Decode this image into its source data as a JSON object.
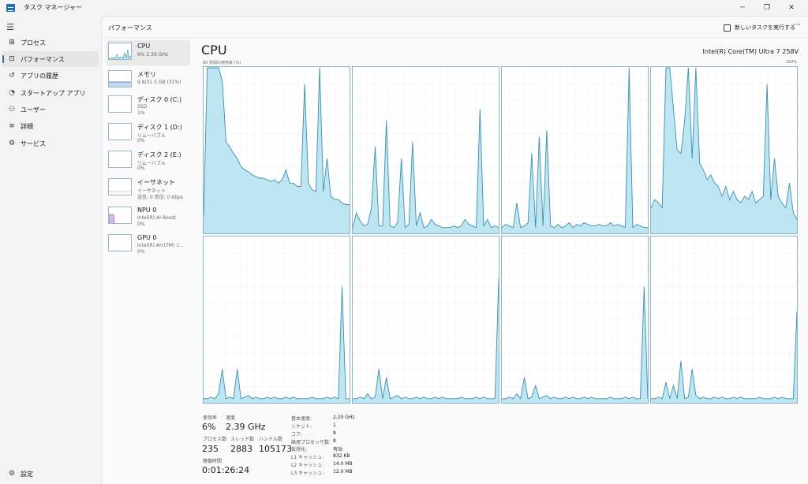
{
  "window": {
    "title": "タスク マネージャー"
  },
  "nav": {
    "items": [
      {
        "label": "プロセス",
        "icon": "grid-icon"
      },
      {
        "label": "パフォーマンス",
        "icon": "pulse-icon"
      },
      {
        "label": "アプリの履歴",
        "icon": "history-icon"
      },
      {
        "label": "スタートアップ アプリ",
        "icon": "gauge-icon"
      },
      {
        "label": "ユーザー",
        "icon": "users-icon"
      },
      {
        "label": "詳細",
        "icon": "list-icon"
      },
      {
        "label": "サービス",
        "icon": "puzzle-icon"
      }
    ],
    "settings": "設定"
  },
  "header": {
    "title": "パフォーマンス",
    "new_task": "新しいタスクを実行する",
    "more": "⋯"
  },
  "devices": [
    {
      "name": "CPU",
      "sub1": "6% 2.39 GHz",
      "sub2": ""
    },
    {
      "name": "メモリ",
      "sub1": "9.8/31.5 GB (31%)",
      "sub2": ""
    },
    {
      "name": "ディスク 0 (C:)",
      "sub1": "SSD",
      "sub2": "1%"
    },
    {
      "name": "ディスク 1 (D:)",
      "sub1": "リムーバブル",
      "sub2": "0%"
    },
    {
      "name": "ディスク 2 (E:)",
      "sub1": "リムーバブル",
      "sub2": "0%"
    },
    {
      "name": "イーサネット",
      "sub1": "イーサネット",
      "sub2": "送信: 0 受信: 0 Kbps"
    },
    {
      "name": "NPU 0",
      "sub1": "Intel(R) AI Boost",
      "sub2": "0%"
    },
    {
      "name": "GPU 0",
      "sub1": "Intel(R) Arc(TM) 1...",
      "sub2": "0%"
    }
  ],
  "cpu": {
    "title": "CPU",
    "model": "Intel(R) Core(TM) Ultra 7 258V",
    "graph_label": "60 秒間の使用率 (%)",
    "graph_max": "100%"
  },
  "stats": {
    "usage_label": "使用率",
    "usage": "6%",
    "speed_label": "速度",
    "speed": "2.39 GHz",
    "processes_label": "プロセス数",
    "processes": "235",
    "threads_label": "スレッド数",
    "threads": "2883",
    "handles_label": "ハンドル数",
    "handles": "105173",
    "uptime_label": "稼働時間",
    "uptime": "0:01:26:24"
  },
  "specs": [
    {
      "label": "基本速度:",
      "value": "2.20 GHz"
    },
    {
      "label": "ソケット:",
      "value": "1"
    },
    {
      "label": "コア:",
      "value": "8"
    },
    {
      "label": "論理プロセッサ数:",
      "value": "8"
    },
    {
      "label": "仮想化:",
      "value": "有効"
    },
    {
      "label": "L1 キャッシュ:",
      "value": "832 KB"
    },
    {
      "label": "L2 キャッシュ:",
      "value": "14.0 MB"
    },
    {
      "label": "L3 キャッシュ:",
      "value": "12.0 MB"
    }
  ],
  "colors": {
    "cpu_fill": "#bde6f2",
    "cpu_line": "#3c8fae",
    "accent": "#1f6fb5",
    "mem_fill": "#c4d9f0",
    "npu_fill": "#d7b9e6"
  },
  "chart_data": [
    {
      "type": "area",
      "name": "core-0",
      "ylim": [
        0,
        100
      ],
      "values": [
        10,
        100,
        100,
        100,
        100,
        92,
        55,
        52,
        48,
        45,
        40,
        38,
        37,
        35,
        34,
        33,
        33,
        32,
        31,
        32,
        30,
        32,
        38,
        30,
        30,
        28,
        28,
        90,
        30,
        26,
        25,
        100,
        25,
        45,
        22,
        20,
        20,
        18,
        17,
        17
      ]
    },
    {
      "type": "area",
      "name": "core-1",
      "ylim": [
        0,
        100
      ],
      "values": [
        3,
        12,
        7,
        4,
        5,
        15,
        52,
        4,
        4,
        68,
        4,
        3,
        6,
        45,
        3,
        5,
        55,
        4,
        12,
        3,
        4,
        8,
        5,
        4,
        3,
        3,
        3,
        4,
        3,
        4,
        8,
        5,
        4,
        3,
        75,
        4,
        8,
        3,
        4,
        3
      ]
    },
    {
      "type": "area",
      "name": "core-2",
      "ylim": [
        0,
        100
      ],
      "values": [
        3,
        5,
        4,
        3,
        18,
        3,
        4,
        6,
        48,
        3,
        58,
        4,
        62,
        4,
        3,
        5,
        3,
        4,
        6,
        3,
        5,
        4,
        6,
        5,
        4,
        4,
        5,
        4,
        4,
        6,
        4,
        5,
        4,
        3,
        100,
        3,
        5,
        4,
        3,
        3
      ]
    },
    {
      "type": "area",
      "name": "core-3",
      "ylim": [
        0,
        100
      ],
      "values": [
        15,
        20,
        18,
        15,
        100,
        100,
        75,
        50,
        48,
        68,
        100,
        45,
        100,
        42,
        38,
        32,
        35,
        30,
        28,
        22,
        28,
        20,
        25,
        20,
        18,
        22,
        20,
        25,
        18,
        20,
        22,
        90,
        20,
        45,
        22,
        18,
        15,
        30,
        12,
        8
      ]
    },
    {
      "type": "area",
      "name": "core-4",
      "ylim": [
        0,
        100
      ],
      "values": [
        2,
        2,
        3,
        2,
        5,
        20,
        2,
        3,
        2,
        20,
        2,
        3,
        4,
        2,
        3,
        2,
        2,
        3,
        2,
        3,
        2,
        2,
        3,
        2,
        3,
        2,
        2,
        2,
        2,
        3,
        2,
        2,
        2,
        3,
        2,
        3,
        2,
        70,
        2,
        2
      ]
    },
    {
      "type": "area",
      "name": "core-5",
      "ylim": [
        0,
        100
      ],
      "values": [
        2,
        2,
        3,
        2,
        5,
        2,
        3,
        20,
        2,
        15,
        2,
        3,
        4,
        2,
        3,
        2,
        2,
        3,
        2,
        3,
        2,
        2,
        3,
        2,
        3,
        2,
        2,
        2,
        2,
        3,
        2,
        2,
        2,
        3,
        2,
        3,
        2,
        2,
        2,
        75
      ]
    },
    {
      "type": "area",
      "name": "core-6",
      "ylim": [
        0,
        100
      ],
      "values": [
        2,
        2,
        3,
        2,
        5,
        2,
        15,
        2,
        3,
        10,
        2,
        3,
        4,
        2,
        3,
        2,
        2,
        3,
        2,
        3,
        2,
        2,
        3,
        2,
        3,
        2,
        2,
        2,
        2,
        3,
        2,
        2,
        2,
        3,
        2,
        3,
        2,
        2,
        70,
        2
      ]
    },
    {
      "type": "area",
      "name": "core-7",
      "ylim": [
        0,
        100
      ],
      "values": [
        2,
        2,
        3,
        2,
        12,
        2,
        10,
        2,
        25,
        2,
        3,
        20,
        4,
        2,
        3,
        2,
        2,
        3,
        2,
        3,
        2,
        2,
        3,
        2,
        3,
        2,
        2,
        2,
        2,
        3,
        2,
        2,
        2,
        3,
        2,
        3,
        2,
        2,
        2,
        55
      ]
    }
  ]
}
